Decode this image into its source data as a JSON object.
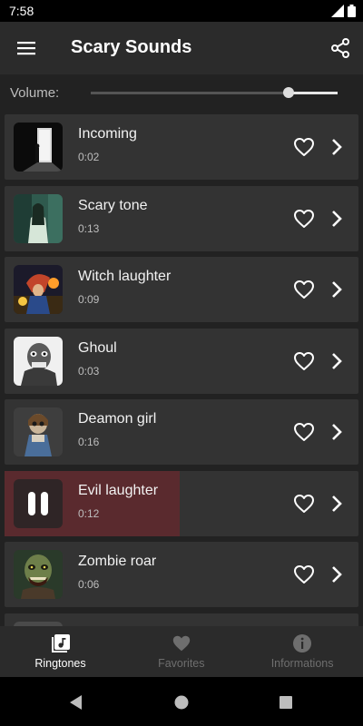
{
  "status": {
    "time": "7:58"
  },
  "header": {
    "title": "Scary Sounds"
  },
  "volume": {
    "label": "Volume:",
    "level": 0.8
  },
  "sounds": [
    {
      "name": "Incoming",
      "duration": "0:02",
      "playing": false
    },
    {
      "name": "Scary tone",
      "duration": "0:13",
      "playing": false
    },
    {
      "name": "Witch laughter",
      "duration": "0:09",
      "playing": false
    },
    {
      "name": "Ghoul",
      "duration": "0:03",
      "playing": false
    },
    {
      "name": "Deamon girl",
      "duration": "0:16",
      "playing": false
    },
    {
      "name": "Evil laughter",
      "duration": "0:12",
      "playing": true
    },
    {
      "name": "Zombie roar",
      "duration": "0:06",
      "playing": false
    }
  ],
  "bottom_nav": [
    {
      "label": "Ringtones",
      "icon": "music-library-icon",
      "active": true
    },
    {
      "label": "Favorites",
      "icon": "heart-icon",
      "active": false
    },
    {
      "label": "Informations",
      "icon": "info-icon",
      "active": false
    }
  ],
  "colors": {
    "background": "#222222",
    "row": "#333333",
    "playing": "#5a2a2e",
    "accent": "#ffffff",
    "inactive": "#6e6e6e"
  }
}
